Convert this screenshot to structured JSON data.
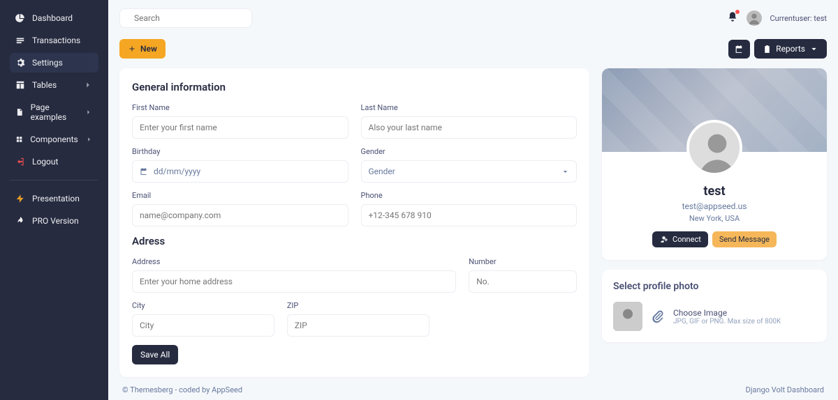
{
  "sidebar": {
    "items": [
      {
        "label": "Dashboard"
      },
      {
        "label": "Transactions"
      },
      {
        "label": "Settings"
      },
      {
        "label": "Tables"
      },
      {
        "label": "Page examples"
      },
      {
        "label": "Components"
      },
      {
        "label": "Logout"
      },
      {
        "label": "Presentation"
      },
      {
        "label": "PRO Version"
      }
    ]
  },
  "search": {
    "placeholder": "Search"
  },
  "user": {
    "label": "Currentuser: test"
  },
  "actions": {
    "new": "New",
    "reports": "Reports"
  },
  "form": {
    "general_heading": "General information",
    "first_name": {
      "label": "First Name",
      "placeholder": "Enter your first name"
    },
    "last_name": {
      "label": "Last Name",
      "placeholder": "Also your last name"
    },
    "birthday": {
      "label": "Birthday",
      "placeholder": "dd/mm/yyyy"
    },
    "gender": {
      "label": "Gender",
      "placeholder": "Gender"
    },
    "email": {
      "label": "Email",
      "placeholder": "name@company.com"
    },
    "phone": {
      "label": "Phone",
      "placeholder": "+12-345 678 910"
    },
    "address_heading": "Adress",
    "address": {
      "label": "Address",
      "placeholder": "Enter your home address"
    },
    "number": {
      "label": "Number",
      "placeholder": "No."
    },
    "city": {
      "label": "City",
      "placeholder": "City"
    },
    "zip": {
      "label": "ZIP",
      "placeholder": "ZIP"
    },
    "save": "Save All"
  },
  "profile": {
    "name": "test",
    "email": "test@appseed.us",
    "location": "New York, USA",
    "connect": "Connect",
    "message": "Send Message"
  },
  "photo": {
    "heading": "Select profile photo",
    "choose": "Choose Image",
    "hint": "JPG, GIF or PNG. Max size of 800K"
  },
  "footer": {
    "left_prefix": "© ",
    "left_link1": "Themesberg",
    "left_mid": " - coded by ",
    "left_link2": "AppSeed",
    "right": "Django Volt Dashboard"
  }
}
